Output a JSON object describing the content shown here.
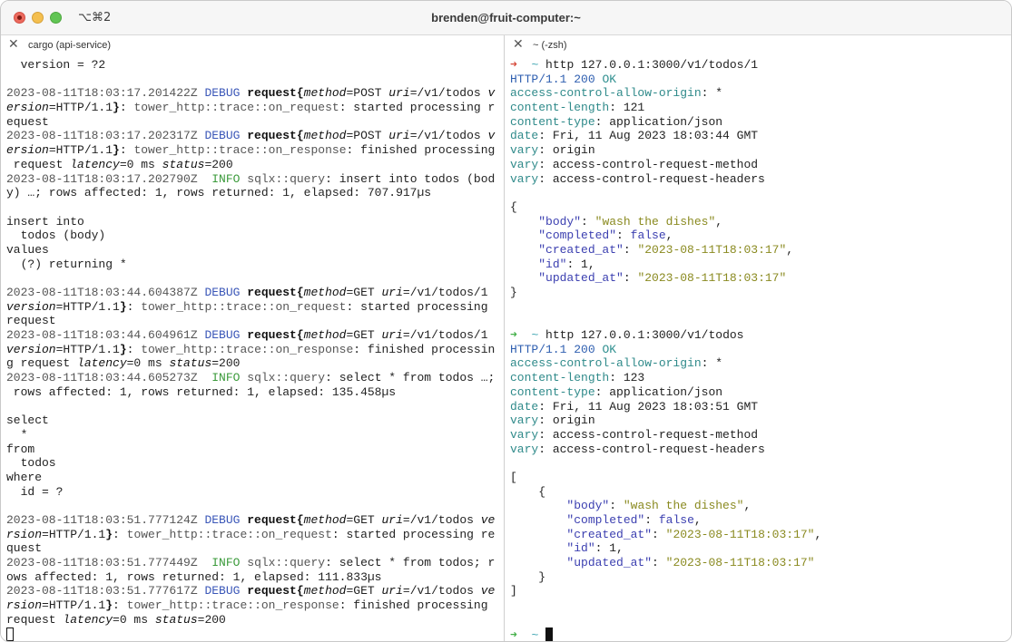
{
  "window": {
    "title": "brenden@fruit-computer:~",
    "shortcut": "⌥⌘2"
  },
  "left_pane": {
    "title": "cargo (api-service)",
    "close_icon": "close-icon",
    "lines": [
      [
        {
          "t": "  version = ?2"
        }
      ],
      [
        {
          "t": ""
        }
      ],
      [
        {
          "c": "ts",
          "t": "2023-08-11T18:03:17.201422Z "
        },
        {
          "c": "debug",
          "t": "DEBUG "
        },
        {
          "c": "kw",
          "t": "request{"
        },
        {
          "c": "field",
          "t": "method"
        },
        {
          "t": "=POST "
        },
        {
          "c": "field",
          "t": "uri"
        },
        {
          "t": "=/v1/todos "
        },
        {
          "c": "field",
          "t": "v"
        }
      ],
      [
        {
          "c": "field",
          "t": "ersion"
        },
        {
          "t": "=HTTP/1.1"
        },
        {
          "c": "kw",
          "t": "}"
        },
        {
          "t": ": "
        },
        {
          "c": "target",
          "t": "tower_http::trace::on_request"
        },
        {
          "t": ": started processing r"
        }
      ],
      [
        {
          "t": "equest"
        }
      ],
      [
        {
          "c": "ts",
          "t": "2023-08-11T18:03:17.202317Z "
        },
        {
          "c": "debug",
          "t": "DEBUG "
        },
        {
          "c": "kw",
          "t": "request{"
        },
        {
          "c": "field",
          "t": "method"
        },
        {
          "t": "=POST "
        },
        {
          "c": "field",
          "t": "uri"
        },
        {
          "t": "=/v1/todos "
        },
        {
          "c": "field",
          "t": "v"
        }
      ],
      [
        {
          "c": "field",
          "t": "ersion"
        },
        {
          "t": "=HTTP/1.1"
        },
        {
          "c": "kw",
          "t": "}"
        },
        {
          "t": ": "
        },
        {
          "c": "target",
          "t": "tower_http::trace::on_response"
        },
        {
          "t": ": finished processing"
        }
      ],
      [
        {
          "t": " request "
        },
        {
          "c": "field",
          "t": "latency"
        },
        {
          "t": "=0 ms "
        },
        {
          "c": "field",
          "t": "status"
        },
        {
          "t": "=200"
        }
      ],
      [
        {
          "c": "ts",
          "t": "2023-08-11T18:03:17.202790Z  "
        },
        {
          "c": "info",
          "t": "INFO "
        },
        {
          "c": "target",
          "t": "sqlx::query"
        },
        {
          "t": ": insert into todos (bod"
        }
      ],
      [
        {
          "t": "y) …; rows affected: 1, rows returned: 1, elapsed: 707.917µs"
        }
      ],
      [
        {
          "t": ""
        }
      ],
      [
        {
          "t": "insert into"
        }
      ],
      [
        {
          "t": "  todos (body)"
        }
      ],
      [
        {
          "t": "values"
        }
      ],
      [
        {
          "t": "  (?) returning *"
        }
      ],
      [
        {
          "t": ""
        }
      ],
      [
        {
          "c": "ts",
          "t": "2023-08-11T18:03:44.604387Z "
        },
        {
          "c": "debug",
          "t": "DEBUG "
        },
        {
          "c": "kw",
          "t": "request{"
        },
        {
          "c": "field",
          "t": "method"
        },
        {
          "t": "=GET "
        },
        {
          "c": "field",
          "t": "uri"
        },
        {
          "t": "=/v1/todos/1"
        }
      ],
      [
        {
          "c": "field",
          "t": "version"
        },
        {
          "t": "=HTTP/1.1"
        },
        {
          "c": "kw",
          "t": "}"
        },
        {
          "t": ": "
        },
        {
          "c": "target",
          "t": "tower_http::trace::on_request"
        },
        {
          "t": ": started processing"
        }
      ],
      [
        {
          "t": "request"
        }
      ],
      [
        {
          "c": "ts",
          "t": "2023-08-11T18:03:44.604961Z "
        },
        {
          "c": "debug",
          "t": "DEBUG "
        },
        {
          "c": "kw",
          "t": "request{"
        },
        {
          "c": "field",
          "t": "method"
        },
        {
          "t": "=GET "
        },
        {
          "c": "field",
          "t": "uri"
        },
        {
          "t": "=/v1/todos/1"
        }
      ],
      [
        {
          "c": "field",
          "t": "version"
        },
        {
          "t": "=HTTP/1.1"
        },
        {
          "c": "kw",
          "t": "}"
        },
        {
          "t": ": "
        },
        {
          "c": "target",
          "t": "tower_http::trace::on_response"
        },
        {
          "t": ": finished processin"
        }
      ],
      [
        {
          "t": "g request "
        },
        {
          "c": "field",
          "t": "latency"
        },
        {
          "t": "=0 ms "
        },
        {
          "c": "field",
          "t": "status"
        },
        {
          "t": "=200"
        }
      ],
      [
        {
          "c": "ts",
          "t": "2023-08-11T18:03:44.605273Z  "
        },
        {
          "c": "info",
          "t": "INFO "
        },
        {
          "c": "target",
          "t": "sqlx::query"
        },
        {
          "t": ": select * from todos …;"
        }
      ],
      [
        {
          "t": " rows affected: 1, rows returned: 1, elapsed: 135.458µs"
        }
      ],
      [
        {
          "t": ""
        }
      ],
      [
        {
          "t": "select"
        }
      ],
      [
        {
          "t": "  *"
        }
      ],
      [
        {
          "t": "from"
        }
      ],
      [
        {
          "t": "  todos"
        }
      ],
      [
        {
          "t": "where"
        }
      ],
      [
        {
          "t": "  id = ?"
        }
      ],
      [
        {
          "t": ""
        }
      ],
      [
        {
          "c": "ts",
          "t": "2023-08-11T18:03:51.777124Z "
        },
        {
          "c": "debug",
          "t": "DEBUG "
        },
        {
          "c": "kw",
          "t": "request{"
        },
        {
          "c": "field",
          "t": "method"
        },
        {
          "t": "=GET "
        },
        {
          "c": "field",
          "t": "uri"
        },
        {
          "t": "=/v1/todos "
        },
        {
          "c": "field",
          "t": "ve"
        }
      ],
      [
        {
          "c": "field",
          "t": "rsion"
        },
        {
          "t": "=HTTP/1.1"
        },
        {
          "c": "kw",
          "t": "}"
        },
        {
          "t": ": "
        },
        {
          "c": "target",
          "t": "tower_http::trace::on_request"
        },
        {
          "t": ": started processing re"
        }
      ],
      [
        {
          "t": "quest"
        }
      ],
      [
        {
          "c": "ts",
          "t": "2023-08-11T18:03:51.777449Z  "
        },
        {
          "c": "info",
          "t": "INFO "
        },
        {
          "c": "target",
          "t": "sqlx::query"
        },
        {
          "t": ": select * from todos; r"
        }
      ],
      [
        {
          "t": "ows affected: 1, rows returned: 1, elapsed: 111.833µs"
        }
      ],
      [
        {
          "c": "ts",
          "t": "2023-08-11T18:03:51.777617Z "
        },
        {
          "c": "debug",
          "t": "DEBUG "
        },
        {
          "c": "kw",
          "t": "request{"
        },
        {
          "c": "field",
          "t": "method"
        },
        {
          "t": "=GET "
        },
        {
          "c": "field",
          "t": "uri"
        },
        {
          "t": "=/v1/todos "
        },
        {
          "c": "field",
          "t": "ve"
        }
      ],
      [
        {
          "c": "field",
          "t": "rsion"
        },
        {
          "t": "=HTTP/1.1"
        },
        {
          "c": "kw",
          "t": "}"
        },
        {
          "t": ": "
        },
        {
          "c": "target",
          "t": "tower_http::trace::on_response"
        },
        {
          "t": ": finished processing"
        }
      ],
      [
        {
          "t": "request "
        },
        {
          "c": "field",
          "t": "latency"
        },
        {
          "t": "=0 ms "
        },
        {
          "c": "field",
          "t": "status"
        },
        {
          "t": "=200"
        }
      ]
    ],
    "cursor": "outline"
  },
  "right_pane": {
    "title": "~ (-zsh)",
    "close_icon": "close-icon",
    "lines": [
      [
        {
          "c": "arrow-red",
          "t": "➜ "
        },
        {
          "c": "tilde",
          "t": " ~ "
        },
        {
          "t": "http 127.0.0.1:3000/v1/todos/1"
        }
      ],
      [
        {
          "c": "http",
          "t": "HTTP/1.1 "
        },
        {
          "c": "http",
          "t": "200 "
        },
        {
          "c": "ok",
          "t": "OK"
        }
      ],
      [
        {
          "c": "hkey",
          "t": "access-control-allow-origin"
        },
        {
          "t": ": *"
        }
      ],
      [
        {
          "c": "hkey",
          "t": "content-length"
        },
        {
          "t": ": 121"
        }
      ],
      [
        {
          "c": "hkey",
          "t": "content-type"
        },
        {
          "t": ": application/json"
        }
      ],
      [
        {
          "c": "hkey",
          "t": "date"
        },
        {
          "t": ": Fri, 11 Aug 2023 18:03:44 GMT"
        }
      ],
      [
        {
          "c": "hkey",
          "t": "vary"
        },
        {
          "t": ": origin"
        }
      ],
      [
        {
          "c": "hkey",
          "t": "vary"
        },
        {
          "t": ": access-control-request-method"
        }
      ],
      [
        {
          "c": "hkey",
          "t": "vary"
        },
        {
          "t": ": access-control-request-headers"
        }
      ],
      [
        {
          "t": ""
        }
      ],
      [
        {
          "t": "{"
        }
      ],
      [
        {
          "t": "    "
        },
        {
          "c": "jkey",
          "t": "\"body\""
        },
        {
          "t": ": "
        },
        {
          "c": "jstr",
          "t": "\"wash the dishes\""
        },
        {
          "t": ","
        }
      ],
      [
        {
          "t": "    "
        },
        {
          "c": "jkey",
          "t": "\"completed\""
        },
        {
          "t": ": "
        },
        {
          "c": "jlit",
          "t": "false"
        },
        {
          "t": ","
        }
      ],
      [
        {
          "t": "    "
        },
        {
          "c": "jkey",
          "t": "\"created_at\""
        },
        {
          "t": ": "
        },
        {
          "c": "jstr",
          "t": "\"2023-08-11T18:03:17\""
        },
        {
          "t": ","
        }
      ],
      [
        {
          "t": "    "
        },
        {
          "c": "jkey",
          "t": "\"id\""
        },
        {
          "t": ": 1,"
        }
      ],
      [
        {
          "t": "    "
        },
        {
          "c": "jkey",
          "t": "\"updated_at\""
        },
        {
          "t": ": "
        },
        {
          "c": "jstr",
          "t": "\"2023-08-11T18:03:17\""
        }
      ],
      [
        {
          "t": "}"
        }
      ],
      [
        {
          "t": ""
        }
      ],
      [
        {
          "t": ""
        }
      ],
      [
        {
          "c": "arrow-green",
          "t": "➜ "
        },
        {
          "c": "tilde",
          "t": " ~ "
        },
        {
          "t": "http 127.0.0.1:3000/v1/todos"
        }
      ],
      [
        {
          "c": "http",
          "t": "HTTP/1.1 "
        },
        {
          "c": "http",
          "t": "200 "
        },
        {
          "c": "ok",
          "t": "OK"
        }
      ],
      [
        {
          "c": "hkey",
          "t": "access-control-allow-origin"
        },
        {
          "t": ": *"
        }
      ],
      [
        {
          "c": "hkey",
          "t": "content-length"
        },
        {
          "t": ": 123"
        }
      ],
      [
        {
          "c": "hkey",
          "t": "content-type"
        },
        {
          "t": ": application/json"
        }
      ],
      [
        {
          "c": "hkey",
          "t": "date"
        },
        {
          "t": ": Fri, 11 Aug 2023 18:03:51 GMT"
        }
      ],
      [
        {
          "c": "hkey",
          "t": "vary"
        },
        {
          "t": ": origin"
        }
      ],
      [
        {
          "c": "hkey",
          "t": "vary"
        },
        {
          "t": ": access-control-request-method"
        }
      ],
      [
        {
          "c": "hkey",
          "t": "vary"
        },
        {
          "t": ": access-control-request-headers"
        }
      ],
      [
        {
          "t": ""
        }
      ],
      [
        {
          "t": "["
        }
      ],
      [
        {
          "t": "    {"
        }
      ],
      [
        {
          "t": "        "
        },
        {
          "c": "jkey",
          "t": "\"body\""
        },
        {
          "t": ": "
        },
        {
          "c": "jstr",
          "t": "\"wash the dishes\""
        },
        {
          "t": ","
        }
      ],
      [
        {
          "t": "        "
        },
        {
          "c": "jkey",
          "t": "\"completed\""
        },
        {
          "t": ": "
        },
        {
          "c": "jlit",
          "t": "false"
        },
        {
          "t": ","
        }
      ],
      [
        {
          "t": "        "
        },
        {
          "c": "jkey",
          "t": "\"created_at\""
        },
        {
          "t": ": "
        },
        {
          "c": "jstr",
          "t": "\"2023-08-11T18:03:17\""
        },
        {
          "t": ","
        }
      ],
      [
        {
          "t": "        "
        },
        {
          "c": "jkey",
          "t": "\"id\""
        },
        {
          "t": ": 1,"
        }
      ],
      [
        {
          "t": "        "
        },
        {
          "c": "jkey",
          "t": "\"updated_at\""
        },
        {
          "t": ": "
        },
        {
          "c": "jstr",
          "t": "\"2023-08-11T18:03:17\""
        }
      ],
      [
        {
          "t": "    }"
        }
      ],
      [
        {
          "t": "]"
        }
      ],
      [
        {
          "t": ""
        }
      ],
      [
        {
          "t": ""
        }
      ],
      [
        {
          "c": "arrow-green",
          "t": "➜ "
        },
        {
          "c": "tilde",
          "t": " ~ "
        }
      ]
    ],
    "cursor": "block"
  }
}
